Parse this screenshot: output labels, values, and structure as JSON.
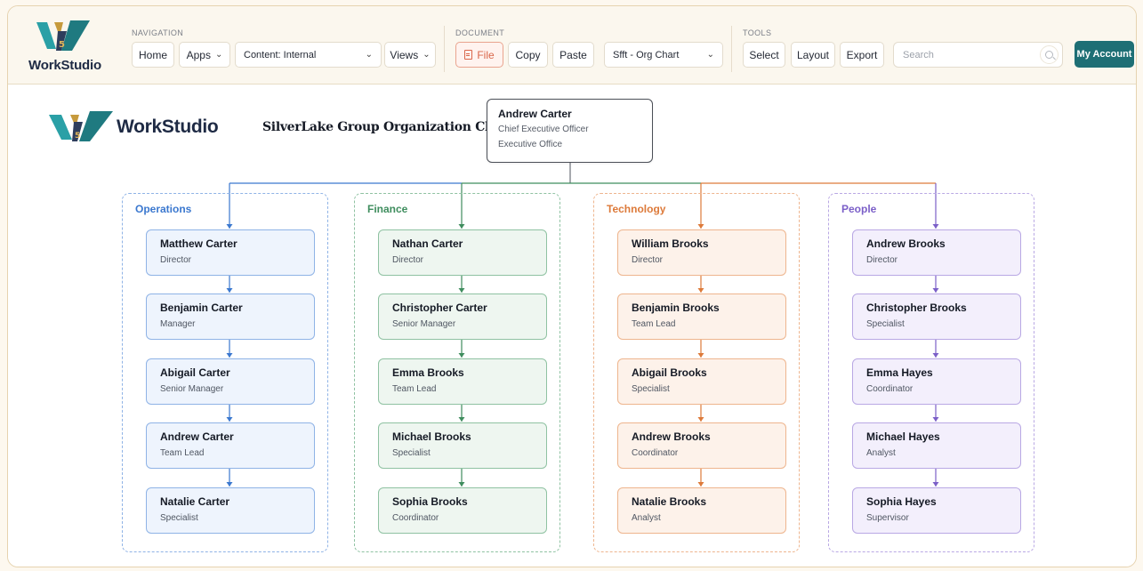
{
  "app": {
    "brand": "WorkStudio"
  },
  "toolbar": {
    "groups": {
      "navigation": "NAVIGATION",
      "document": "DOCUMENT",
      "tools": "TOOLS"
    },
    "home": "Home",
    "apps": "Apps",
    "content_select": "Content: Internal",
    "views": "Views",
    "file": "File",
    "copy": "Copy",
    "paste": "Paste",
    "doc_select": "Sfft - Org Chart",
    "select": "Select",
    "layout": "Layout",
    "export": "Export",
    "search_placeholder": "Search",
    "account": "My Account"
  },
  "chart": {
    "brand": "WorkStudio",
    "title": "SilverLake Group Organization Chart",
    "ceo": {
      "name": "Andrew Carter",
      "title": "Chief Executive Officer",
      "unit": "Executive Office"
    },
    "departments": [
      {
        "name": "Operations",
        "color": "#3b78cf",
        "border": "#8fb3e6",
        "card_bg": "#eef4fd",
        "members": [
          {
            "name": "Matthew Carter",
            "role": "Director"
          },
          {
            "name": "Benjamin Carter",
            "role": "Manager"
          },
          {
            "name": "Abigail Carter",
            "role": "Senior Manager"
          },
          {
            "name": "Andrew Carter",
            "role": "Team Lead"
          },
          {
            "name": "Natalie Carter",
            "role": "Specialist"
          }
        ]
      },
      {
        "name": "Finance",
        "color": "#3f8d5e",
        "border": "#8fc2a2",
        "card_bg": "#eef6f0",
        "members": [
          {
            "name": "Nathan Carter",
            "role": "Director"
          },
          {
            "name": "Christopher Carter",
            "role": "Senior Manager"
          },
          {
            "name": "Emma Brooks",
            "role": "Team Lead"
          },
          {
            "name": "Michael Brooks",
            "role": "Specialist"
          },
          {
            "name": "Sophia Brooks",
            "role": "Coordinator"
          }
        ]
      },
      {
        "name": "Technology",
        "color": "#dd7a3a",
        "border": "#eeb58e",
        "card_bg": "#fdf2ea",
        "members": [
          {
            "name": "William Brooks",
            "role": "Director"
          },
          {
            "name": "Benjamin Brooks",
            "role": "Team Lead"
          },
          {
            "name": "Abigail Brooks",
            "role": "Specialist"
          },
          {
            "name": "Andrew Brooks",
            "role": "Coordinator"
          },
          {
            "name": "Natalie Brooks",
            "role": "Analyst"
          }
        ]
      },
      {
        "name": "People",
        "color": "#7b5fc8",
        "border": "#b9a8e4",
        "card_bg": "#f3effc",
        "members": [
          {
            "name": "Andrew Brooks",
            "role": "Director"
          },
          {
            "name": "Christopher Brooks",
            "role": "Specialist"
          },
          {
            "name": "Emma Hayes",
            "role": "Coordinator"
          },
          {
            "name": "Michael Hayes",
            "role": "Analyst"
          },
          {
            "name": "Sophia Hayes",
            "role": "Supervisor"
          }
        ]
      }
    ]
  }
}
